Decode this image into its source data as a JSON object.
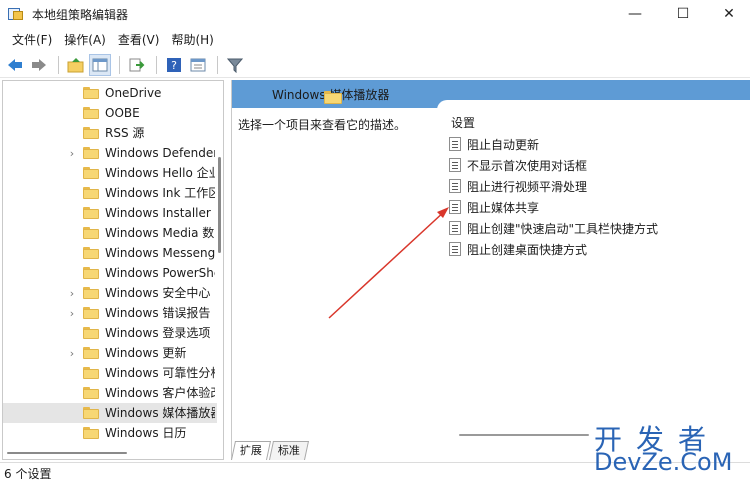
{
  "window": {
    "title": "本地组策略编辑器",
    "minimize": "—",
    "maximize": "☐",
    "close": "✕"
  },
  "menu": [
    "文件(F)",
    "操作(A)",
    "查看(V)",
    "帮助(H)"
  ],
  "toolbar": {
    "icons": [
      "back-arrow-icon",
      "forward-arrow-icon",
      "up-folder-icon",
      "show-hide-tree-icon",
      "export-list-icon",
      "help-icon",
      "properties-icon",
      "filter-icon"
    ]
  },
  "tree": {
    "items": [
      {
        "label": "OneDrive",
        "expandable": false,
        "selected": false
      },
      {
        "label": "OOBE",
        "expandable": false,
        "selected": false
      },
      {
        "label": "RSS 源",
        "expandable": false,
        "selected": false
      },
      {
        "label": "Windows Defender",
        "expandable": true,
        "selected": false
      },
      {
        "label": "Windows Hello 企业版",
        "expandable": false,
        "selected": false
      },
      {
        "label": "Windows Ink 工作区",
        "expandable": false,
        "selected": false
      },
      {
        "label": "Windows Installer",
        "expandable": false,
        "selected": false
      },
      {
        "label": "Windows Media 数字权限管理",
        "expandable": false,
        "selected": false
      },
      {
        "label": "Windows Messenger",
        "expandable": false,
        "selected": false
      },
      {
        "label": "Windows PowerShell",
        "expandable": false,
        "selected": false
      },
      {
        "label": "Windows 安全中心",
        "expandable": true,
        "selected": false
      },
      {
        "label": "Windows 错误报告",
        "expandable": true,
        "selected": false
      },
      {
        "label": "Windows 登录选项",
        "expandable": false,
        "selected": false
      },
      {
        "label": "Windows 更新",
        "expandable": true,
        "selected": false
      },
      {
        "label": "Windows 可靠性分析",
        "expandable": false,
        "selected": false
      },
      {
        "label": "Windows 客户体验改善计划",
        "expandable": false,
        "selected": false
      },
      {
        "label": "Windows 媒体播放器",
        "expandable": false,
        "selected": true
      },
      {
        "label": "Windows 日历",
        "expandable": false,
        "selected": false
      }
    ]
  },
  "right": {
    "header_title": "Windows 媒体播放器",
    "description": "选择一个项目来查看它的描述。",
    "column_header": "设置",
    "settings": [
      "阻止自动更新",
      "不显示首次使用对话框",
      "阻止进行视频平滑处理",
      "阻止媒体共享",
      "阻止创建\"快速启动\"工具栏快捷方式",
      "阻止创建桌面快捷方式"
    ]
  },
  "tabs": [
    "扩展",
    "标准"
  ],
  "status": "6 个设置",
  "watermark": {
    "line1": "开发者",
    "line2": "DevZe.CoM"
  },
  "colors": {
    "header": "#5e9bd5",
    "accent": "#2a64b5",
    "arrow": "#d9362b"
  }
}
